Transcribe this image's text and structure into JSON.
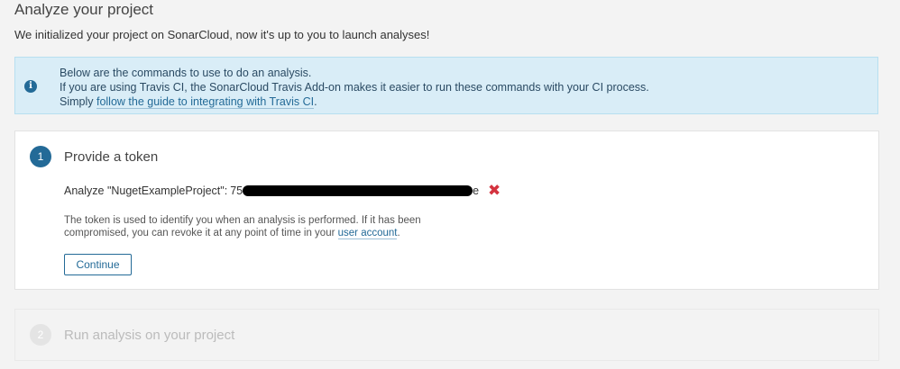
{
  "header": {
    "title": "Analyze your project",
    "description": "We initialized your project on SonarCloud, now it's up to you to launch analyses!"
  },
  "info": {
    "icon": "info-icon",
    "line1": "Below are the commands to use to do an analysis.",
    "line2": "If you are using Travis CI, the SonarCloud Travis Add-on makes it easier to run these commands with your CI process.",
    "line3_prefix": "Simply ",
    "line3_link": "follow the guide to integrating with Travis CI",
    "line3_suffix": "."
  },
  "step1": {
    "number": "1",
    "title": "Provide a token",
    "token_label": "Analyze \"NugetExampleProject\":",
    "token_prefix": "75",
    "token_suffix": "e",
    "revoke_icon": "close-icon",
    "help_text": "The token is used to identify you when an analysis is performed. If it has been compromised, you can revoke it at any point of time in your ",
    "help_link": "user account",
    "help_suffix": ".",
    "continue_label": "Continue"
  },
  "step2": {
    "number": "2",
    "title": "Run analysis on your project"
  },
  "colors": {
    "accent": "#236a97",
    "info_bg": "#d9edf7",
    "danger": "#d4333f"
  }
}
